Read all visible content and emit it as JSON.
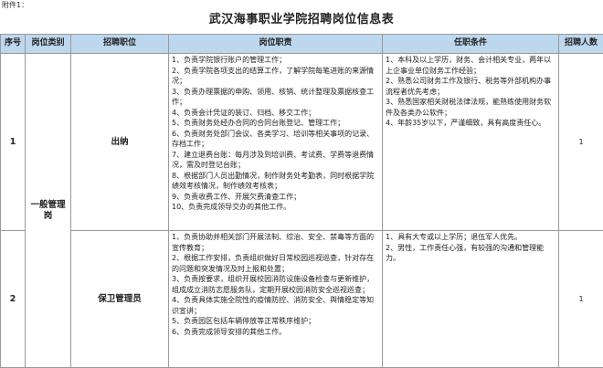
{
  "attachment": "附件1：",
  "title": "武汉海事职业学院招聘岗位信息表",
  "headers": {
    "seq": "序号",
    "category": "岗位类别",
    "position": "招聘职位",
    "duties": "岗位职责",
    "requirements": "任职条件",
    "count": "招聘人数"
  },
  "category_name": "一般管理岗",
  "rows": [
    {
      "seq": "1",
      "position": "出纳",
      "count": "1",
      "duties": [
        "1、负责学院银行账户的管理工作；",
        "2、负责学院各项支出的结算工作，了解学院每笔进账的来源情况；",
        "3、负责办理票据的申购、领用、核销、统计整理及票据核查工作；",
        "4、负责会计凭证的装订、归档、移交工作；",
        "5、负责财务处经办合同的合同台账登记、管理工作；",
        "6、负责财务处部门会议、各类学习、培训等相关事项的记录、存档工作；",
        "7、建立退费台账：每月涉及到培训费、考试费、学费等退费情况，需及时登记台账；",
        "8、根据部门人员出勤情况，制作财务处考勤表，同时根据学院绩效考核情况，制作绩效考核表；",
        "9、负责收费工作、开展欠费清查工作；",
        "10、负责完成领导交办的其他工作。"
      ],
      "requirements": [
        "1、本科及以上学历，财务、会计相关专业，两年以上企事业单位财务工作经验；",
        "2、熟悉公司财务工作及银行、税务等外部机构办事流程者优先考虑；",
        "3、熟悉国家相关财税法律法规，能熟练使用财务软件及各类办公软件；",
        "4、年龄35岁以下，严谨细致，具有高度责任心。"
      ]
    },
    {
      "seq": "2",
      "position": "保卫管理员",
      "count": "1",
      "duties": [
        "1、负责协助并相关部门开展法制、综治、安全、禁毒等方面的宣传教育；",
        "2、根据工作安排，负责组织做好日常校园巡视巡查，针对存在的问题和突发情况及时上报和处置；",
        "3、负责按要求，组织开展校园消防设施设备检查与更新维护，组成成立消防志愿服务队，定期开展校园消防安全巡视巡查；",
        "4、负责具体实施全院性的疫情防控、消防安全、舆情稳定等知识宣讲；",
        "5、负责园区包括车辆停放等正常秩序维护；",
        "6、负责完成领导安排的其他工作。"
      ],
      "requirements": [
        "1、具有大专或以上学历；退伍军人优先。",
        "2、男性，工作责任心强，有较强的沟通和管理能力。"
      ]
    }
  ]
}
